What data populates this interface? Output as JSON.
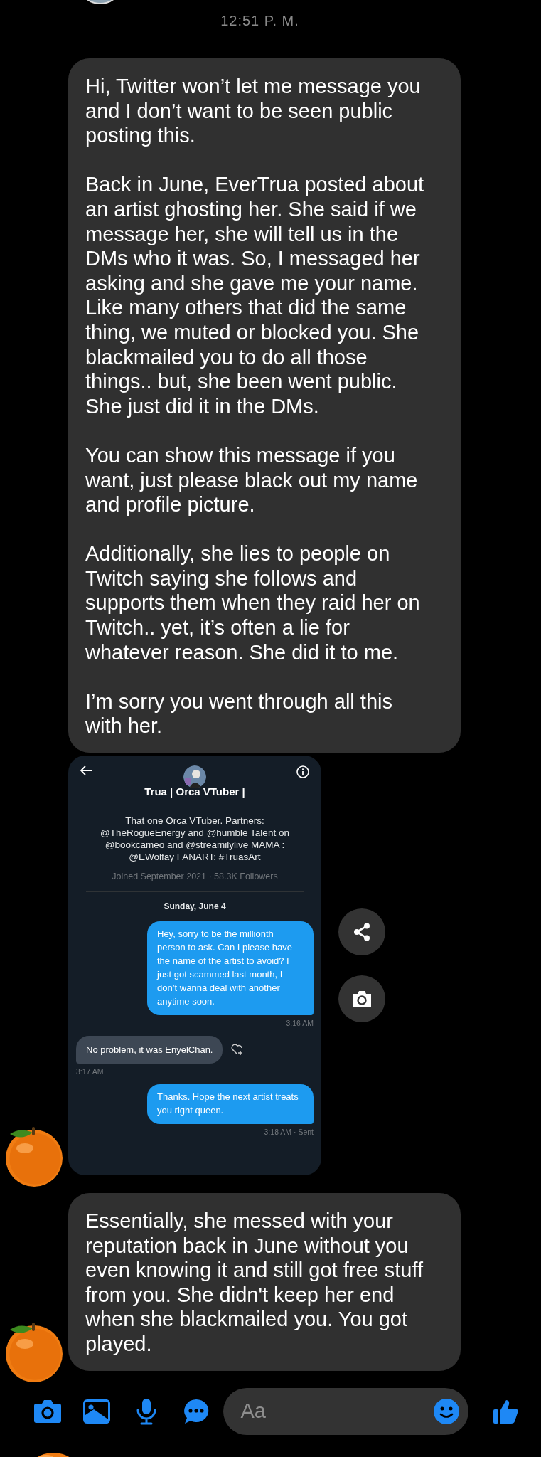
{
  "header": {
    "timestamp": "12:51 P. M."
  },
  "messages": [
    {
      "kind": "text",
      "show_avatar": false,
      "paragraphs": [
        "Hi, Twitter won’t let me message you and I don’t want to be seen public posting this.",
        "Back in June, EverTrua posted about an artist ghosting her. She said if we message her, she will tell us in the DMs who it was. So, I messaged her asking and she gave me your name. Like many others that did the same thing, we muted or blocked you. She blackmailed you to do all those things.. but, she been went public. She just did it in the DMs.",
        "You can show this message if you want, just please black out my name and profile picture.",
        "Additionally, she lies to people on Twitch saying she follows and supports them when they raid her on Twitch.. yet, it’s often a lie for whatever reason. She did it to me.",
        "I’m sorry you went through all this with her."
      ]
    },
    {
      "kind": "screenshot",
      "show_avatar": true,
      "profile": {
        "name": "Trua | Orca VTuber |",
        "bio": "That one Orca VTuber. Partners: @TheRogueEnergy and @humble Talent on @bookcameo and @streamilylive MAMA : @EWolfay FANART: #TruasArt",
        "joined": "Joined September 2021 · 58.3K Followers"
      },
      "date": "Sunday, June 4",
      "dms": [
        {
          "kind": "outgoing",
          "text": "Hey, sorry to be the millionth person to ask. Can I please have the name of the artist to avoid? I just got scammed last month, I don’t wanna deal with another anytime soon.",
          "time": "3:16 AM"
        },
        {
          "kind": "incoming",
          "text": "No problem, it was EnyelChan.",
          "time": "3:17 AM"
        },
        {
          "kind": "outgoing",
          "text": "Thanks. Hope the next artist treats you right queen.",
          "time": "3:18 AM · Sent"
        }
      ]
    },
    {
      "kind": "text",
      "show_avatar": true,
      "paragraphs": [
        "Essentially, she messed with your reputation back in June without you even knowing it and still got free stuff from you. She didn't keep her end when she blackmailed you. You got played."
      ]
    }
  ],
  "composer": {
    "placeholder": "Aa"
  }
}
